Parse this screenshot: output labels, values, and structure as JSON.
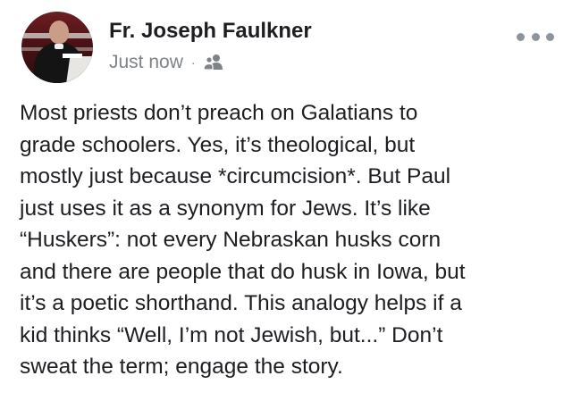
{
  "post": {
    "author": "Fr. Joseph Faulkner",
    "timestamp": "Just now",
    "separator": "·",
    "audience_icon": "friends-icon",
    "more_icon": "more-options-icon",
    "body": "Most priests don’t preach on Galatians to\ngrade schoolers. Yes, it’s theological, but\nmostly just because *circumcision*. But Paul\njust uses it as a synonym for Jews. It’s like\n“Huskers”: not every Nebraskan husks corn\nand there are people that do husk in Iowa, but\nit’s a poetic shorthand. This analogy helps if a\nkid thinks “Well, I’m not Jewish, but...” Don’t\nsweat the term; engage the story."
  },
  "colors": {
    "text": "#1c1e21",
    "meta": "#7f8388",
    "icon": "#8d949e"
  }
}
